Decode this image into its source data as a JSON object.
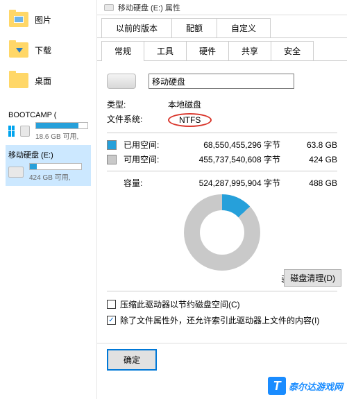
{
  "sidebar": {
    "nav": [
      {
        "label": "图片"
      },
      {
        "label": "下载"
      },
      {
        "label": "桌面"
      }
    ],
    "drives": [
      {
        "name": "BOOTCAMP (",
        "sub": "18.6 GB 可用,",
        "fill_pct": 82,
        "selected": false,
        "windows": true
      },
      {
        "name": "移动硬盘 (E:)",
        "sub": "424 GB 可用,",
        "fill_pct": 13,
        "selected": true,
        "windows": false
      }
    ]
  },
  "dialog": {
    "title": "移动硬盘 (E:) 属性",
    "tabs_top": [
      "以前的版本",
      "配额",
      "自定义"
    ],
    "tabs_bottom": [
      "常规",
      "工具",
      "硬件",
      "共享",
      "安全"
    ],
    "active_tab": "常规",
    "name_value": "移动硬盘",
    "type_label": "类型:",
    "type_value": "本地磁盘",
    "fs_label": "文件系统:",
    "fs_value": "NTFS",
    "used": {
      "label": "已用空间:",
      "bytes": "68,550,455,296 字节",
      "human": "63.8 GB"
    },
    "free": {
      "label": "可用空间:",
      "bytes": "455,737,540,608 字节",
      "human": "424 GB"
    },
    "capacity": {
      "label": "容量:",
      "bytes": "524,287,995,904 字节",
      "human": "488 GB"
    },
    "drive_letter": "驱动器 E:",
    "cleanup_btn": "磁盘清理(D)",
    "check_compress": "压缩此驱动器以节约磁盘空间(C)",
    "check_index": "除了文件属性外，还允许索引此驱动器上文件的内容(I)",
    "compress_checked": false,
    "index_checked": true,
    "ok_btn": "确定"
  },
  "watermark": "泰尔达游戏网"
}
